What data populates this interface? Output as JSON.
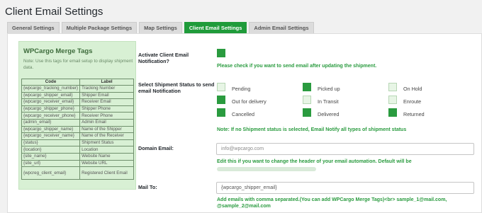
{
  "page": {
    "title": "Client Email Settings"
  },
  "tabs": [
    {
      "label": "General Settings",
      "active": false
    },
    {
      "label": "Multiple Package Settings",
      "active": false
    },
    {
      "label": "Map Settings",
      "active": false
    },
    {
      "label": "Client Email Settings",
      "active": true
    },
    {
      "label": "Admin Email Settings",
      "active": false
    }
  ],
  "merge_tags": {
    "title": "WPCargo Merge Tags",
    "note": "Note: Use this tags for email setup to display shipment data.",
    "headers": [
      "Code",
      "Label"
    ],
    "rows": [
      [
        "{wpcargo_tracking_number}",
        "Tracking Number"
      ],
      [
        "{wpcargo_shipper_email}",
        "Shipper Email"
      ],
      [
        "{wpcargo_receiver_email}",
        "Receiver Email"
      ],
      [
        "{wpcargo_shipper_phone}",
        "Shipper Phone"
      ],
      [
        "{wpcargo_receiver_phone}",
        "Receiver Phone"
      ],
      [
        "{admin_email}",
        "Admin Email"
      ],
      [
        "{wpcargo_shipper_name}",
        "Name of the Shipper"
      ],
      [
        "{wpcargo_receiver_name}",
        "Name of the Receiver"
      ],
      [
        "{status}",
        "Shipment Status"
      ],
      [
        "{location}",
        "Location"
      ],
      [
        "{site_name}",
        "Website Name"
      ],
      [
        "{site_url}",
        "Website URL"
      ],
      [
        "{wpcreg_client_email}",
        "Registered Client Email"
      ]
    ]
  },
  "form": {
    "activate": {
      "label": "Activate Client Email Notification?",
      "checked": true,
      "hint": "Please check if you want to send email after updating the shipment."
    },
    "statuses": {
      "label": "Select Shipment Status to send email Notification",
      "items": [
        {
          "label": "Pending",
          "checked": false
        },
        {
          "label": "Picked up",
          "checked": true
        },
        {
          "label": "On Hold",
          "checked": false
        },
        {
          "label": "Out for delivery",
          "checked": true
        },
        {
          "label": "In Transit",
          "checked": false
        },
        {
          "label": "Enroute",
          "checked": false
        },
        {
          "label": "Cancelled",
          "checked": true
        },
        {
          "label": "Delivered",
          "checked": true
        },
        {
          "label": "Returned",
          "checked": true
        }
      ],
      "note": "Note: If no Shipment status is selected, Email Notify all types of shipment status"
    },
    "domain_email": {
      "label": "Domain Email:",
      "placeholder": "info@wpcargo.com",
      "hint": "Edit this if you want to change the header of your email automation. Default will be"
    },
    "mail_to": {
      "label": "Mail To:",
      "value": "{wpcargo_shipper_email}",
      "hint": "Add emails with comma separated.(You can add WPCargo Merge Tags)<br> sample_1@mail.com, @sample_2@mail.com"
    }
  },
  "colors": {
    "accent": "#2a9b3f",
    "tab_active": "#1f9b3a",
    "merge_bg": "#d8f0d4"
  }
}
